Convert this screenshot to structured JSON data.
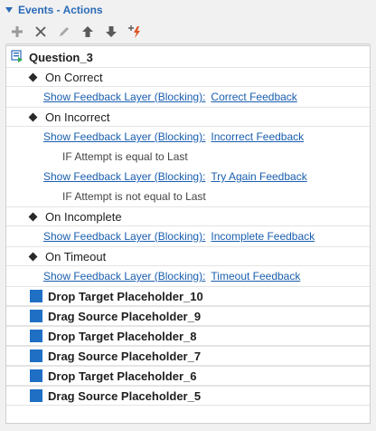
{
  "panel": {
    "title": "Events - Actions"
  },
  "toolbar": {
    "items": [
      {
        "name": "add-icon"
      },
      {
        "name": "delete-icon"
      },
      {
        "name": "edit-icon"
      },
      {
        "name": "move-up-icon"
      },
      {
        "name": "move-down-icon"
      },
      {
        "name": "add-trigger-icon"
      }
    ]
  },
  "tree": {
    "root": "Question_3",
    "events": {
      "correct": "On Correct",
      "incorrect": "On Incorrect",
      "incomplete": "On Incomplete",
      "timeout": "On Timeout"
    },
    "action_label": "Show Feedback Layer (Blocking):",
    "targets": {
      "correct": "Correct Feedback",
      "incorrect": "Incorrect Feedback",
      "try_again": "Try Again Feedback",
      "incomplete": "Incomplete Feedback",
      "timeout": "Timeout Feedback"
    },
    "conditions": {
      "equal": "IF Attempt is equal to Last",
      "not_equal": "IF Attempt is not equal to Last"
    },
    "placeholders": [
      "Drop Target Placeholder_10",
      "Drag Source Placeholder_9",
      "Drop Target Placeholder_8",
      "Drag Source Placeholder_7",
      "Drop Target Placeholder_6",
      "Drag Source Placeholder_5"
    ]
  },
  "colors": {
    "accent": "#2a6ab8",
    "link": "#1a5eae",
    "placeholder_square": "#1f6fc5"
  }
}
